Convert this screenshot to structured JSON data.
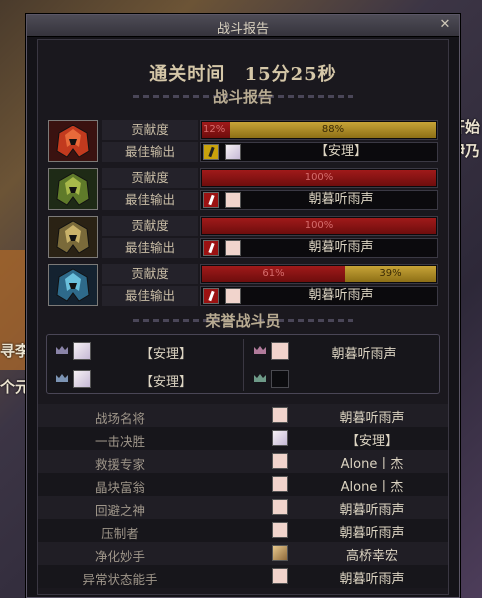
{
  "window": {
    "title": "战斗报告"
  },
  "clear_time": {
    "label": "通关时间",
    "value": "15分25秒"
  },
  "report_header": "战斗报告",
  "stat_labels": {
    "contribution": "贡献度",
    "best_output": "最佳输出"
  },
  "players": [
    {
      "icon": "red-helmet-icon",
      "contribution_text": [
        "12%",
        "88%"
      ],
      "contribution_split": [
        0.12,
        0.88
      ],
      "best_name": "【安理】"
    },
    {
      "icon": "green-helmet-icon",
      "contribution_text": [
        "100%"
      ],
      "contribution_split": [
        1.0
      ],
      "best_name": "朝暮听雨声"
    },
    {
      "icon": "gold-helmet-icon",
      "contribution_text": [
        "100%"
      ],
      "contribution_split": [
        1.0
      ],
      "best_name": "朝暮听雨声"
    },
    {
      "icon": "blue-helmet-icon",
      "contribution_text": [
        "61%",
        "39%"
      ],
      "contribution_split": [
        0.61,
        0.39
      ],
      "best_name": "朝暮听雨声"
    }
  ],
  "honor_header": "荣誉战斗员",
  "honor": [
    {
      "name": "【安理】"
    },
    {
      "name": "朝暮听雨声"
    },
    {
      "name": "【安理】"
    },
    {
      "name": ""
    }
  ],
  "awards": [
    {
      "title": "战场名将",
      "name": "朝暮听雨声"
    },
    {
      "title": "一击决胜",
      "name": "【安理】"
    },
    {
      "title": "救援专家",
      "name": "Alone丨杰"
    },
    {
      "title": "晶块富翁",
      "name": "Alone丨杰"
    },
    {
      "title": "回避之神",
      "name": "朝暮听雨声"
    },
    {
      "title": "压制者",
      "name": "朝暮听雨声"
    },
    {
      "title": "净化妙手",
      "name": "高桥幸宏"
    },
    {
      "title": "异常状态能手",
      "name": "朝暮听雨声"
    }
  ],
  "background_text": {
    "right_top": "开始",
    "right_second": "伊乃",
    "left_mid": "寻李哥",
    "left_low": "个元"
  },
  "colors": {
    "bar_red": "#8e1414",
    "bar_gold": "#b8941f",
    "panel_bg": "#141318"
  }
}
